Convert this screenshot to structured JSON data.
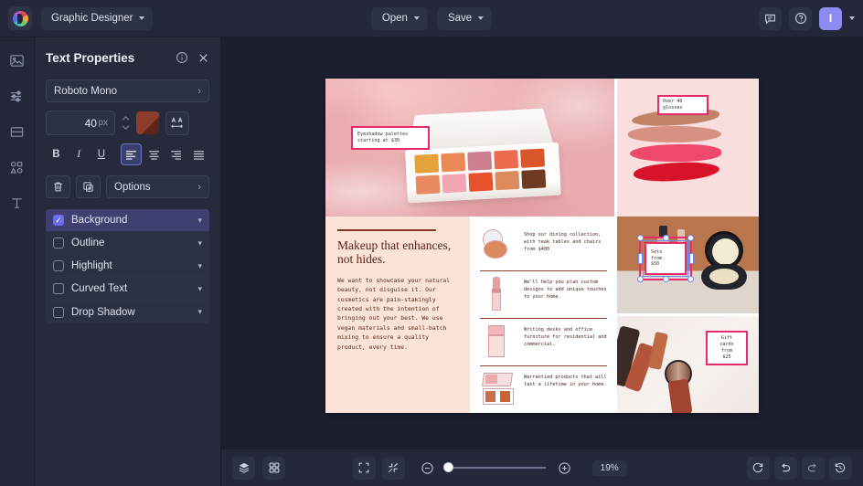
{
  "topbar": {
    "logo_icon": "color-wheel-logo",
    "document_name": "Graphic Designer",
    "open_label": "Open",
    "save_label": "Save",
    "comment_icon": "comment-icon",
    "help_icon": "help-circle-icon",
    "avatar_initial": "I"
  },
  "rail": {
    "items": [
      {
        "name": "image-tool",
        "icon": "image-icon"
      },
      {
        "name": "adjustments-tool",
        "icon": "sliders-icon"
      },
      {
        "name": "layout-tool",
        "icon": "layout-icon"
      },
      {
        "name": "shapes-tool",
        "icon": "shapes-icon"
      },
      {
        "name": "text-tool",
        "icon": "text-icon"
      }
    ]
  },
  "panel": {
    "title": "Text Properties",
    "info_icon": "info-icon",
    "close_icon": "close-icon",
    "font_family": "Roboto Mono",
    "font_size": "40",
    "font_size_unit": "px",
    "color_swatch": "#8e3c2c",
    "letter_spacing_icon": "letter-spacing-icon",
    "bold_label": "B",
    "italic_label": "I",
    "underline_label": "U",
    "align_left_icon": "align-left-icon",
    "align_center_icon": "align-center-icon",
    "align_right_icon": "align-right-icon",
    "align_justify_icon": "align-justify-icon",
    "delete_icon": "trash-icon",
    "duplicate_icon": "duplicate-icon",
    "options_label": "Options",
    "effects": [
      {
        "label": "Background",
        "checked": true,
        "selected": true
      },
      {
        "label": "Outline",
        "checked": false,
        "selected": false
      },
      {
        "label": "Highlight",
        "checked": false,
        "selected": false
      },
      {
        "label": "Curved Text",
        "checked": false,
        "selected": false
      },
      {
        "label": "Drop Shadow",
        "checked": false,
        "selected": false
      }
    ]
  },
  "canvas": {
    "labels": {
      "eyeshadow": "Eyeshadow palettes\nstarting at $30",
      "gloss": "Over 40\nglosses",
      "sets": "Sets\nfrom\n$50",
      "gift": "Gift\ncards\nfrom\n$25"
    },
    "headline": "Makeup that enhances, not hides.",
    "body": "We want to showcase your natural beauty, not disguise it. Our cosmetics are pain-stakingly created with the intention of bringing out your best. We use vegan materials and small-batch mixing to ensure a quality product, every time.",
    "list_items": [
      {
        "art": "compact-powder-art",
        "text": "Shop our dining collection, with teak tables and chairs from $400"
      },
      {
        "art": "lipstick-art",
        "text": "We'll help you plan custom designs to add unique touches to your home."
      },
      {
        "art": "bottle-art",
        "text": "Writing desks and office furniture for residential and commercial."
      },
      {
        "art": "blush-palette-art",
        "text": "Warrantied products that will last a lifetime in your home."
      }
    ],
    "accent_pink": "#e8296d"
  },
  "bottombar": {
    "layers_icon": "layers-icon",
    "grid_icon": "grid-icon",
    "fit_icon": "fit-screen-icon",
    "shrink_icon": "shrink-icon",
    "zoom_out_icon": "zoom-out-icon",
    "zoom_in_icon": "zoom-in-icon",
    "zoom_level": "19%",
    "reset_icon": "reset-icon",
    "undo_icon": "undo-icon",
    "redo_icon": "redo-icon",
    "history_icon": "history-icon"
  }
}
